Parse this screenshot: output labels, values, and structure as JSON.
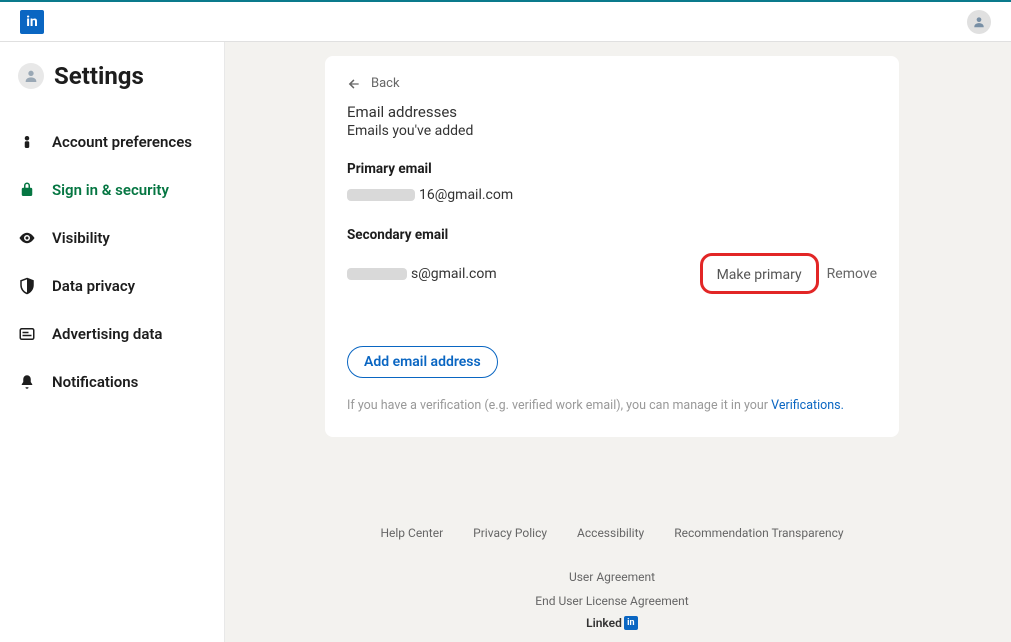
{
  "header": {
    "logo_text": "in"
  },
  "sidebar": {
    "title": "Settings",
    "items": [
      {
        "label": "Account preferences",
        "icon": "person"
      },
      {
        "label": "Sign in & security",
        "icon": "lock",
        "active": true
      },
      {
        "label": "Visibility",
        "icon": "eye"
      },
      {
        "label": "Data privacy",
        "icon": "shield"
      },
      {
        "label": "Advertising data",
        "icon": "ad"
      },
      {
        "label": "Notifications",
        "icon": "bell"
      }
    ]
  },
  "content": {
    "back_label": "Back",
    "title": "Email addresses",
    "subtitle": "Emails you've added",
    "primary_label": "Primary email",
    "primary_email_suffix": "16@gmail.com",
    "secondary_label": "Secondary email",
    "secondary_email_suffix": "s@gmail.com",
    "make_primary_label": "Make primary",
    "remove_label": "Remove",
    "add_button": "Add email address",
    "verification_note": "If you have a verification (e.g. verified work email), you can manage it in your ",
    "verification_link": "Verifications."
  },
  "footer": {
    "links": [
      "Help Center",
      "Privacy Policy",
      "Accessibility",
      "Recommendation Transparency",
      "User Agreement",
      "End User License Agreement"
    ],
    "brand_prefix": "Linked",
    "brand_logo": "in"
  }
}
